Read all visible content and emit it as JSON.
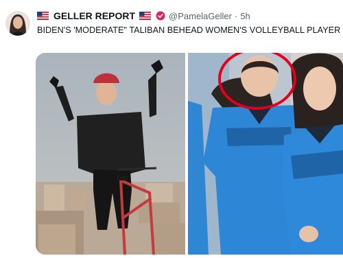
{
  "tweet": {
    "author_name": "GELLER REPORT",
    "handle": "@PamelaGeller",
    "separator": "·",
    "time": "5h",
    "text": "BIDEN'S 'MODERATE\" TALIBAN BEHEAD WOMEN'S VOLLEYBALL PLAYER"
  },
  "icons": {
    "flag": "us-flag-icon",
    "verified": "verified-badge-icon"
  },
  "colors": {
    "highlight_circle": "#e3001b",
    "jersey_blue": "#2e86d6",
    "sky_left": "#b3bcc4"
  },
  "media": {
    "left": "woman-with-bicycle-photo",
    "right": "volleyball-team-photo"
  }
}
